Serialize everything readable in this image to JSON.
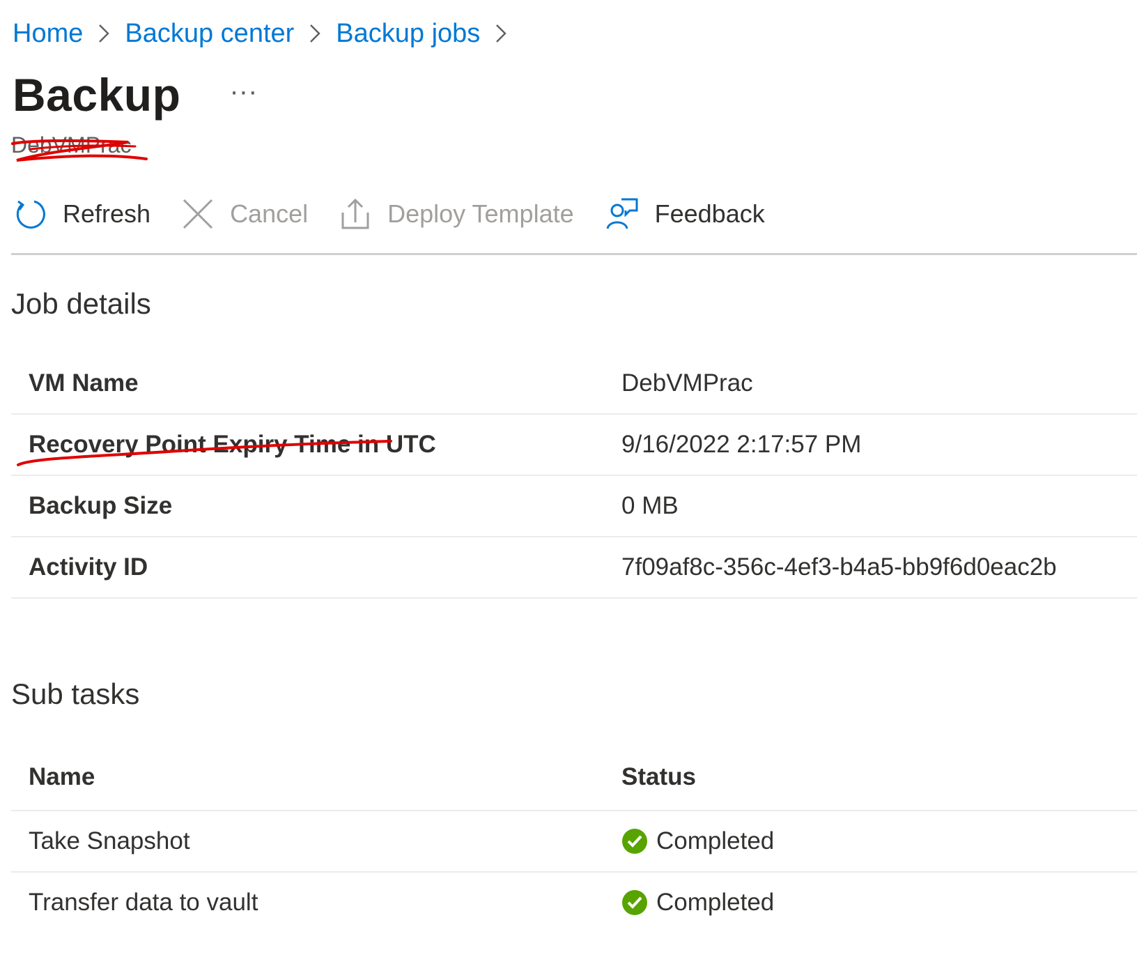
{
  "breadcrumb": {
    "items": [
      "Home",
      "Backup center",
      "Backup jobs"
    ]
  },
  "header": {
    "title": "Backup",
    "more_label": "···",
    "subtitle": "DebVMPrac"
  },
  "toolbar": {
    "refresh": "Refresh",
    "cancel": "Cancel",
    "deploy_template": "Deploy Template",
    "feedback": "Feedback"
  },
  "job_details": {
    "heading": "Job details",
    "rows": [
      {
        "label": "VM Name",
        "value": "DebVMPrac"
      },
      {
        "label": "Recovery Point Expiry Time in UTC",
        "value": "9/16/2022 2:17:57 PM"
      },
      {
        "label": "Backup Size",
        "value": "0 MB"
      },
      {
        "label": "Activity ID",
        "value": "7f09af8c-356c-4ef3-b4a5-bb9f6d0eac2b"
      }
    ]
  },
  "sub_tasks": {
    "heading": "Sub tasks",
    "columns": [
      "Name",
      "Status"
    ],
    "rows": [
      {
        "name": "Take Snapshot",
        "status": "Completed"
      },
      {
        "name": "Transfer data to vault",
        "status": "Completed"
      }
    ]
  },
  "colors": {
    "link": "#0078d4",
    "success": "#57a300",
    "annotation": "#e00000"
  },
  "icons": {
    "refresh": "refresh-icon",
    "cancel": "close-icon",
    "deploy": "upload-icon",
    "feedback": "feedback-icon",
    "status": "check-circle-icon"
  }
}
